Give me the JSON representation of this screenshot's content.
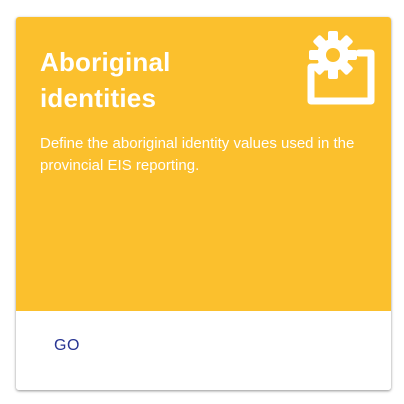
{
  "card": {
    "title": "Aboriginal identities",
    "description": "Define the aboriginal identity values used in the provincial EIS reporting.",
    "icon": "settings-applications-icon",
    "go_label": "GO"
  },
  "colors": {
    "header_background": "#FBC02D",
    "header_text": "#FFFFFF",
    "action_text": "#283593"
  }
}
